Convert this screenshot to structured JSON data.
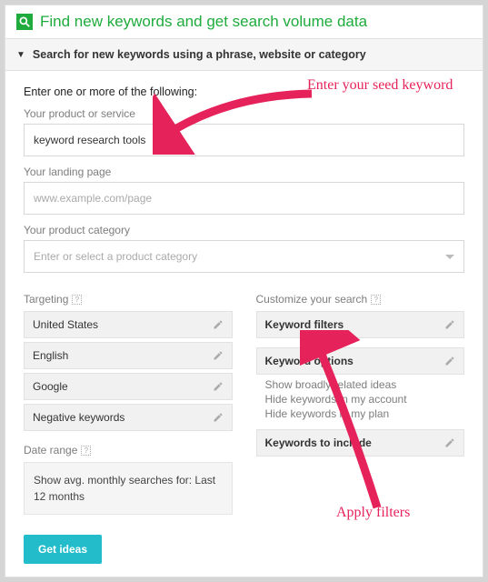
{
  "header": {
    "title": "Find new keywords and get search volume data",
    "icon_name": "search-icon"
  },
  "accordion": {
    "label": "Search for new keywords using a phrase, website or category"
  },
  "form": {
    "intro": "Enter one or more of the following:",
    "product": {
      "label": "Your product or service",
      "value": "keyword research tools"
    },
    "landing": {
      "label": "Your landing page",
      "placeholder": "www.example.com/page"
    },
    "category": {
      "label": "Your product category",
      "placeholder": "Enter or select a product category"
    }
  },
  "targeting": {
    "title": "Targeting",
    "items": [
      "United States",
      "English",
      "Google",
      "Negative keywords"
    ]
  },
  "daterange": {
    "title": "Date range",
    "text": "Show avg. monthly searches for: Last 12 months"
  },
  "customize": {
    "title": "Customize your search",
    "filters_label": "Keyword filters",
    "options_label": "Keyword options",
    "options_lines": [
      "Show broadly related ideas",
      "Hide keywords in my account",
      "Hide keywords in my plan"
    ],
    "include_label": "Keywords to include"
  },
  "cta": {
    "label": "Get ideas"
  },
  "annotations": {
    "seed": "Enter your seed keyword",
    "filters": "Apply filters"
  }
}
